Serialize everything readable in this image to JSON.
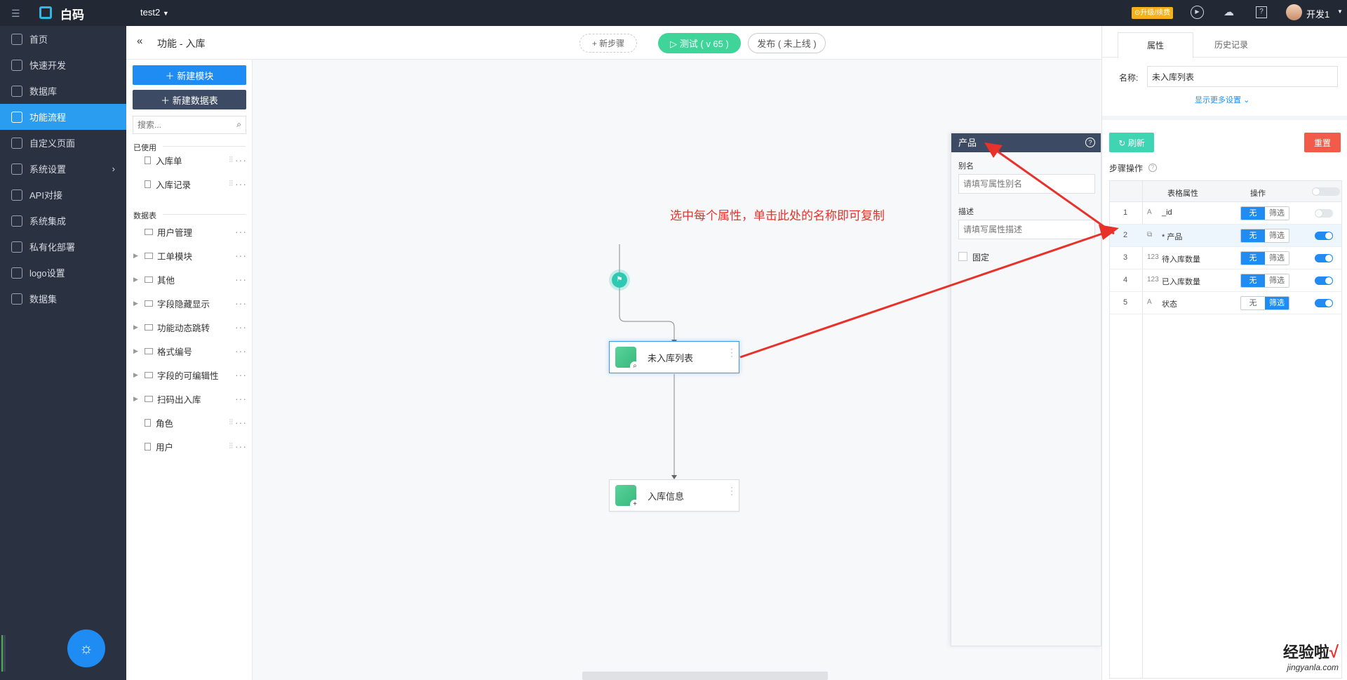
{
  "topbar": {
    "logo_text": "白码",
    "project": "test2",
    "upgrade_label": "升级/续费",
    "user_name": "开发1"
  },
  "nav": [
    {
      "label": "首页",
      "icon": "home-icon"
    },
    {
      "label": "快速开发",
      "icon": "cube-icon"
    },
    {
      "label": "数据库",
      "icon": "database-icon"
    },
    {
      "label": "功能流程",
      "icon": "flow-icon",
      "active": true
    },
    {
      "label": "自定义页面",
      "icon": "page-icon"
    },
    {
      "label": "系统设置",
      "icon": "settings-icon"
    },
    {
      "label": "API对接",
      "icon": "api-icon"
    },
    {
      "label": "系统集成",
      "icon": "integration-icon"
    },
    {
      "label": "私有化部署",
      "icon": "lock-icon"
    },
    {
      "label": "logo设置",
      "icon": "logo-icon"
    },
    {
      "label": "数据集",
      "icon": "dataset-icon"
    }
  ],
  "header": {
    "title": "功能 - 入库",
    "new_step": "+ 新步骤",
    "test_label": "测试 ( v 65 )",
    "publish_label": "发布 ( 未上线 )"
  },
  "tree": {
    "new_module": "新建模块",
    "new_table": "新建数据表",
    "search_placeholder": "搜索...",
    "used_title": "已使用",
    "used_items": [
      "入库单",
      "入库记录"
    ],
    "tables_title": "数据表",
    "table_items": [
      "用户管理",
      "工单模块",
      "其他",
      "字段隐藏显示",
      "功能动态跳转",
      "格式编号",
      "字段的可编辑性",
      "扫码出入库",
      "角色",
      "用户"
    ]
  },
  "flow": {
    "node1": "未入库列表",
    "node2": "入库信息"
  },
  "annotation": "选中每个属性，单击此处的名称即可复制",
  "field_panel": {
    "title": "产品",
    "alias_label": "别名",
    "alias_placeholder": "请填写属性别名",
    "desc_label": "描述",
    "desc_placeholder": "请填写属性描述",
    "fixed_label": "固定"
  },
  "rpanel": {
    "tabs": [
      "属性",
      "历史记录"
    ],
    "name_label": "名称:",
    "name_value": "未入库列表",
    "more_settings": "显示更多设置",
    "refresh": "刷新",
    "reset": "重置",
    "step_ops": "步骤操作",
    "col_attr": "表格属性",
    "col_op": "操作",
    "seg_none": "无",
    "seg_filter": "筛选",
    "rows": [
      {
        "no": "1",
        "type": "A",
        "name": "_id",
        "filter": false,
        "on": false
      },
      {
        "no": "2",
        "type": "ref",
        "name": "* 产品",
        "filter": false,
        "on": true
      },
      {
        "no": "3",
        "type": "123",
        "name": "待入库数量",
        "filter": false,
        "on": true
      },
      {
        "no": "4",
        "type": "123",
        "name": "已入库数量",
        "filter": false,
        "on": true
      },
      {
        "no": "5",
        "type": "A",
        "name": "状态",
        "filter": true,
        "on": true
      }
    ]
  },
  "watermark": {
    "main": "经验啦",
    "check": "√",
    "url": "jingyanla.com"
  }
}
